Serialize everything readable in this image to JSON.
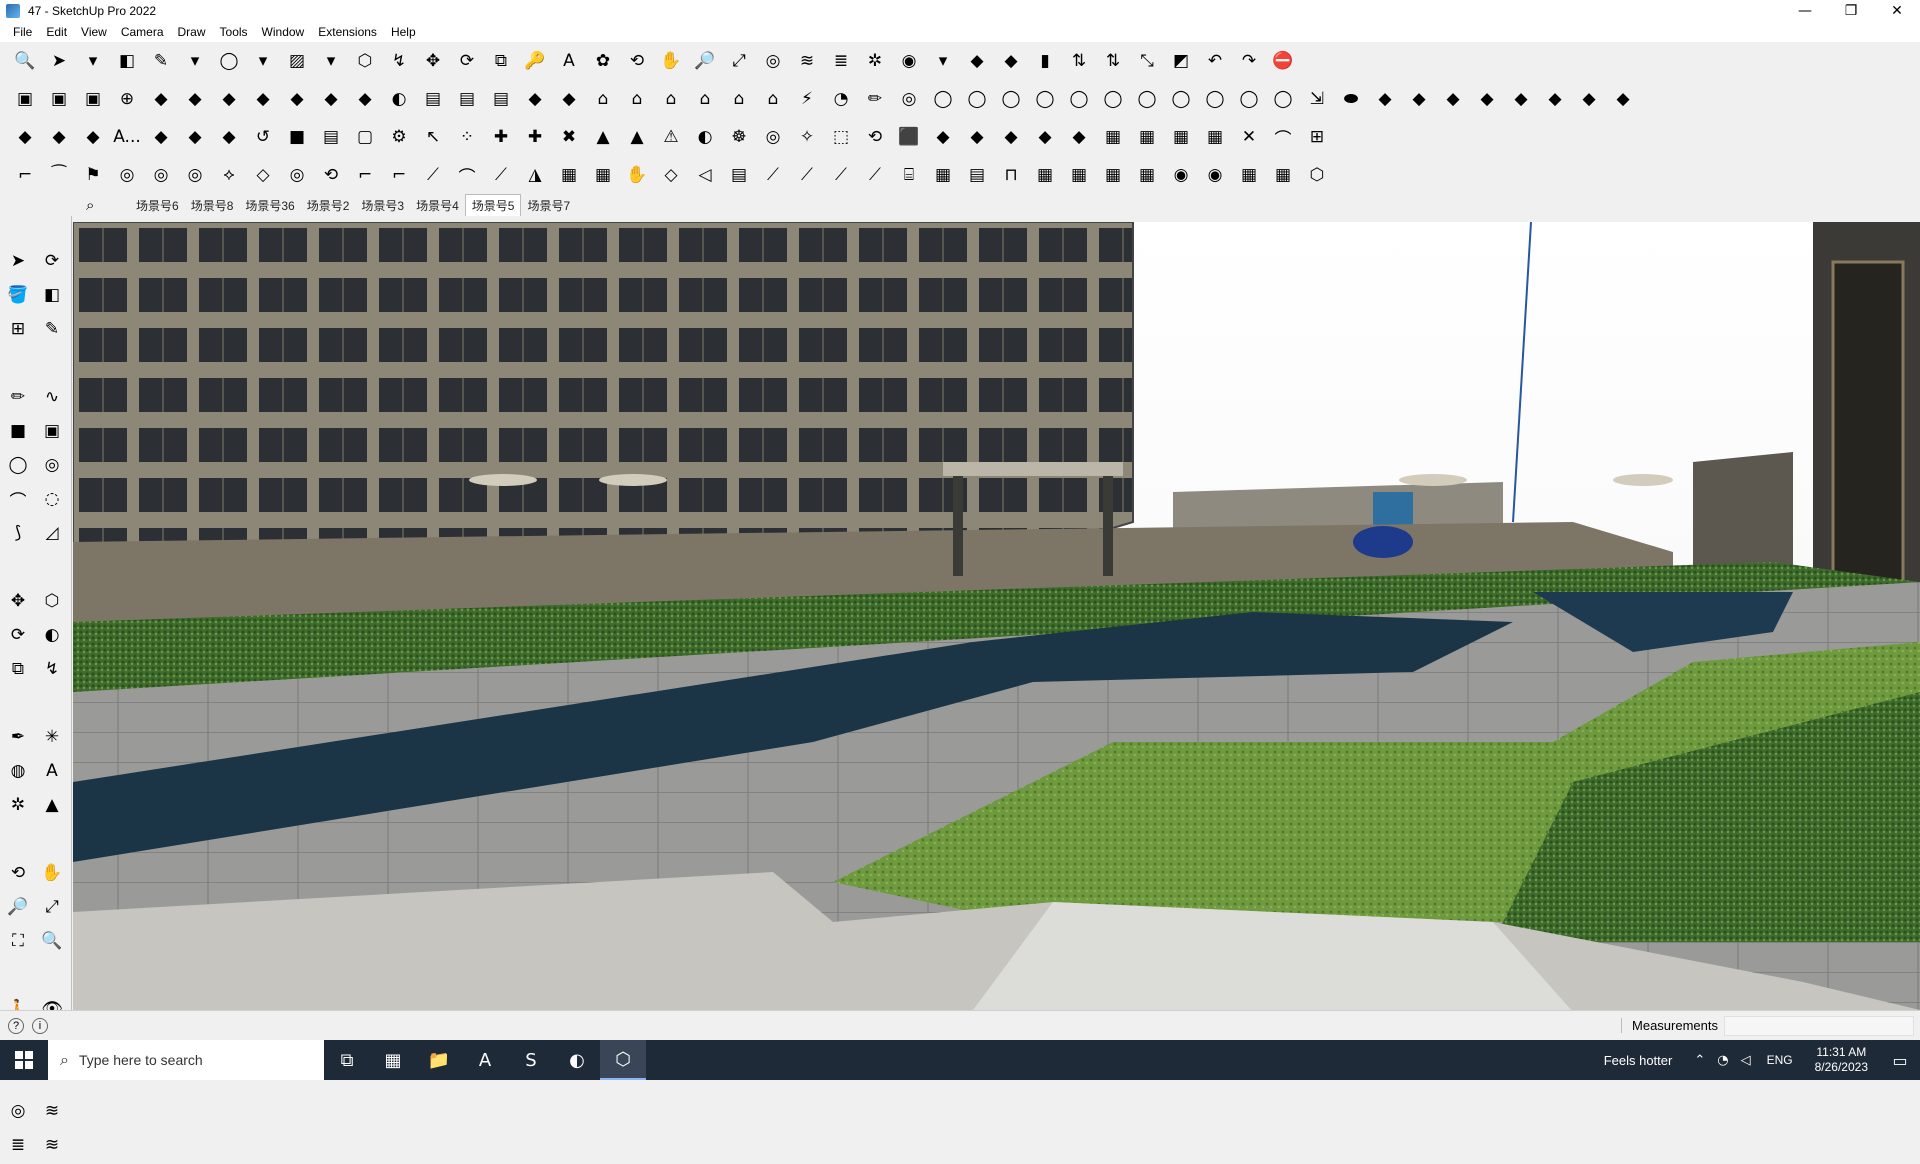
{
  "window": {
    "title": "47 - SketchUp Pro 2022",
    "minimize": "—",
    "maximize": "❐",
    "close": "✕"
  },
  "menu": [
    "File",
    "Edit",
    "View",
    "Camera",
    "Draw",
    "Tools",
    "Window",
    "Extensions",
    "Help"
  ],
  "toolbars": {
    "row1": [
      "🔍",
      "➤",
      "▾",
      "◧",
      "✎",
      "▾",
      "◯",
      "▾",
      "▨",
      "▾",
      "⬡",
      "↯",
      "✥",
      "⟳",
      "⧉",
      "🔑",
      "A",
      "✿",
      "⟲",
      "✋",
      "🔎",
      "⤢",
      "◎",
      "≋",
      "≣",
      "✲",
      "◉",
      "▾",
      "◆",
      "◆",
      "▮",
      "⇅",
      "⇅",
      "⤡",
      "◩",
      "↶",
      "↷",
      "⛔"
    ],
    "row2": [
      "▣",
      "▣",
      "▣",
      "⊕",
      "◆",
      "◆",
      "◆",
      "◆",
      "◆",
      "◆",
      "◆",
      "◐",
      "▤",
      "▤",
      "▤",
      "◆",
      "◆",
      "⌂",
      "⌂",
      "⌂",
      "⌂",
      "⌂",
      "⌂",
      "⚡",
      "◔",
      "✏",
      "◎",
      "◯",
      "◯",
      "◯",
      "◯",
      "◯",
      "◯",
      "◯",
      "◯",
      "◯",
      "◯",
      "◯",
      "⇲",
      "⬬",
      "◆",
      "◆",
      "◆",
      "◆",
      "◆",
      "◆",
      "◆",
      "◆"
    ],
    "row3": [
      "◆",
      "◆",
      "◆",
      "A...",
      "◆",
      "◆",
      "◆",
      "↺",
      "■",
      "▤",
      "▢",
      "⚙",
      "↖",
      "⁘",
      "✚",
      "✚",
      "✖",
      "▲",
      "▲",
      "⚠",
      "◐",
      "☸",
      "◎",
      "✧",
      "⬚",
      "⟲",
      "⬛",
      "◆",
      "◆",
      "◆",
      "◆",
      "◆",
      "▦",
      "▦",
      "▦",
      "▦",
      "✕",
      "⌒",
      "⊞"
    ],
    "row4": [
      "⌐",
      "⁀",
      "⚑",
      "◎",
      "◎",
      "◎",
      "⟡",
      "◇",
      "◎",
      "⟲",
      "⌐",
      "⌐",
      "⟋",
      "⌒",
      "⟋",
      "◮",
      "▦",
      "▦",
      "✋",
      "◇",
      "◁",
      "▤",
      "⟋",
      "⟋",
      "⟋",
      "⟋",
      "⌸",
      "▦",
      "▤",
      "⊓",
      "▦",
      "▦",
      "▦",
      "▦",
      "◉",
      "◉",
      "▦",
      "▦",
      "⬡"
    ]
  },
  "scene_search": "⌕",
  "scenes": [
    "场景号6",
    "场景号8",
    "场景号36",
    "场景号2",
    "场景号3",
    "场景号4",
    "场景号5",
    "场景号7"
  ],
  "active_scene": "场景号5",
  "palette": [
    [
      "➤",
      "⟳"
    ],
    [
      "🪣",
      "◧"
    ],
    [
      "⊞",
      "✎"
    ],
    [
      "✏",
      "∿"
    ],
    [
      "■",
      "▣"
    ],
    [
      "◯",
      "◎"
    ],
    [
      "⌒",
      "◌"
    ],
    [
      "⟆",
      "◿"
    ],
    [
      "✥",
      "⬡"
    ],
    [
      "⟳",
      "◐"
    ],
    [
      "⧉",
      "↯"
    ],
    [
      "✒",
      "✳"
    ],
    [
      "◍",
      "A"
    ],
    [
      "✲",
      "▲"
    ],
    [
      "⟲",
      "✋"
    ],
    [
      "🔎",
      "⤢"
    ],
    [
      "⛶",
      "🔍"
    ],
    [
      "🚶",
      "👁"
    ],
    [
      "👣",
      "⊕"
    ],
    [
      "◎",
      "≋"
    ],
    [
      "≣",
      "≋"
    ]
  ],
  "status": {
    "measurements_label": "Measurements",
    "info_icon": "i",
    "help_icon": "?"
  },
  "taskbar": {
    "search_placeholder": "Type here to search",
    "apps": [
      "⧉",
      "▦",
      "📁",
      "A",
      "S",
      "◐",
      "⬡"
    ],
    "weather": "Feels hotter",
    "language": "ENG",
    "time": "11:31 AM",
    "date": "8/26/2023"
  }
}
